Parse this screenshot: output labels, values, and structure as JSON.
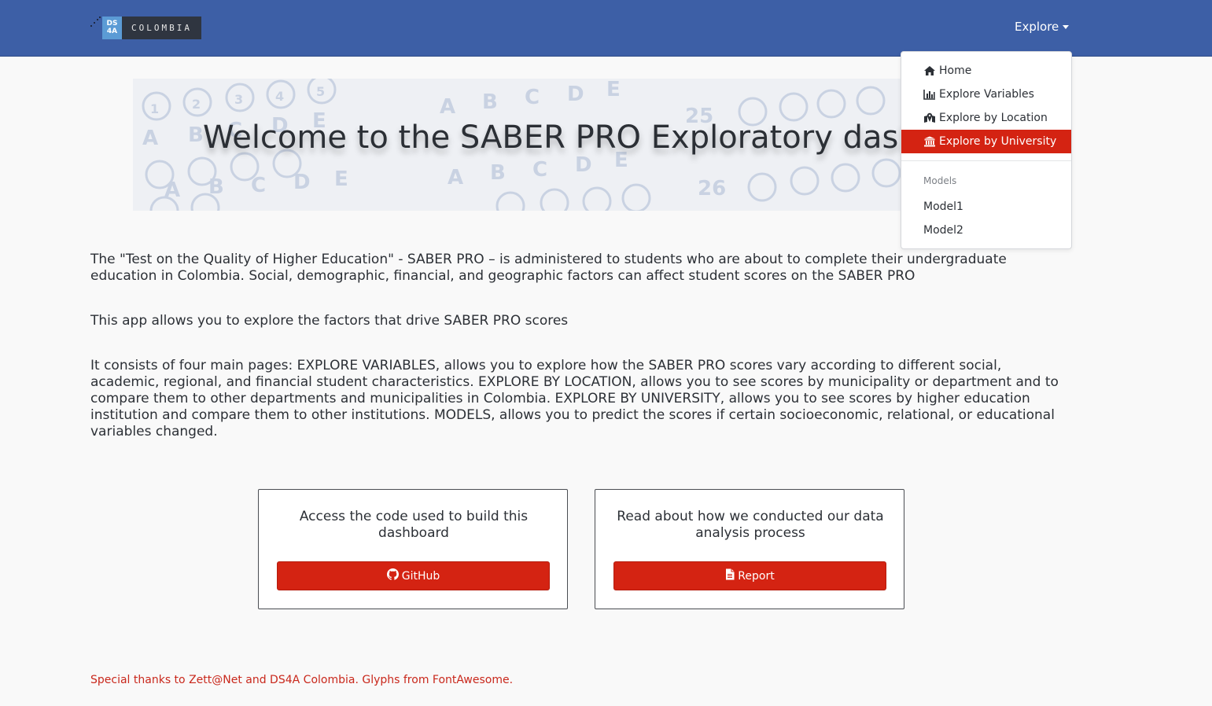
{
  "navbar": {
    "brand_ds": "DS",
    "brand_4a": "4A",
    "brand_name": "COLOMBIA",
    "explore_label": "Explore",
    "background": "#3d5fa6"
  },
  "dropdown": {
    "items": [
      {
        "label": "Home",
        "icon": "home-icon"
      },
      {
        "label": "Explore Variables",
        "icon": "bar-chart-icon"
      },
      {
        "label": "Explore by Location",
        "icon": "map-marker-icon"
      },
      {
        "label": "Explore by University",
        "icon": "university-icon",
        "active": true
      }
    ],
    "models_header": "Models",
    "models": [
      {
        "label": "Model1"
      },
      {
        "label": "Model2"
      }
    ]
  },
  "hero": {
    "title": "Welcome to the SABER PRO Exploratory dashboard"
  },
  "intro": {
    "p1": "The \"Test on the Quality of Higher Education\" - SABER PRO – is administered to students who are about to complete their undergraduate education in Colombia. Social, demographic, financial, and geographic factors can affect student scores on the SABER PRO",
    "p2": "This app allows you to explore the factors that drive SABER PRO scores",
    "p3": "It consists of four main pages: EXPLORE VARIABLES, allows you to explore how the SABER PRO scores vary according to different social, academic, regional, and financial student characteristics. EXPLORE BY LOCATION, allows you to see scores by municipality or department and to compare them to other departments and municipalities in Colombia. EXPLORE BY UNIVERSITY, allows you to see scores by higher education institution and compare them to other institutions. MODELS, allows you to predict the scores if certain socioeconomic, relational, or educational variables changed."
  },
  "cards": {
    "code": {
      "text": "Access the code used to build this dashboard",
      "button": "GitHub",
      "icon": "github-icon"
    },
    "report": {
      "text": "Read about how we conducted our data analysis process",
      "button": "Report",
      "icon": "file-icon"
    }
  },
  "footer": {
    "text": "Special thanks to Zett@Net and DS4A Colombia. Glyphs from FontAwesome."
  },
  "colors": {
    "accent_red": "#d42312",
    "footer_red": "#c9281c"
  }
}
